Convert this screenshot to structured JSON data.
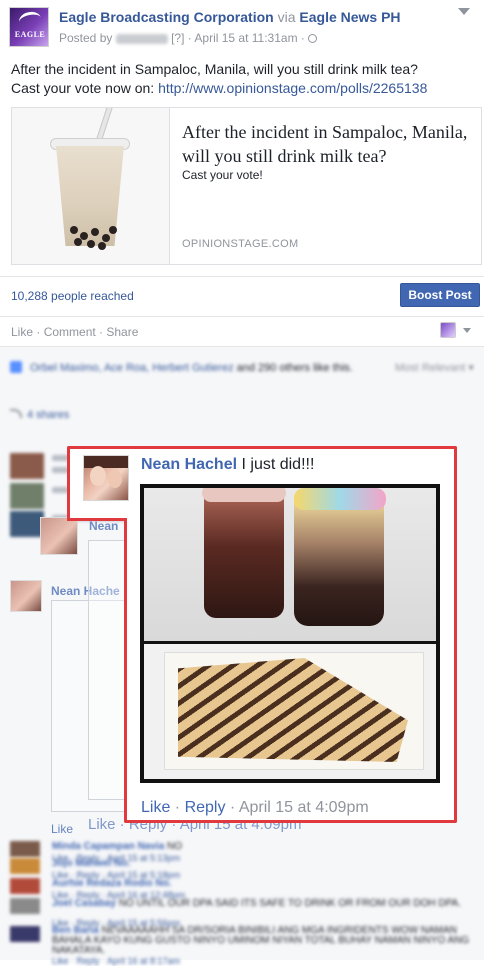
{
  "post": {
    "page_name": "Eagle Broadcasting Corporation",
    "via": "via",
    "via_page": "Eagle News PH",
    "posted_by_label": "Posted by",
    "meta_suffix": "[?] · April 15 at 11:31am ·",
    "avatar_logo_text": "EAGLE",
    "text_line1": "After the incident in Sampaloc, Manila, will you still drink milk tea?",
    "text_line2_prefix": "Cast your vote now on: ",
    "text_link": "http://www.opinionstage.com/polls/2265138"
  },
  "link_card": {
    "title": "After the incident in Sampaloc, Manila, will you still drink milk tea?",
    "description": "Cast your vote!",
    "domain": "OPINIONSTAGE.COM"
  },
  "stats": {
    "reach": "10,288 people reached",
    "boost_label": "Boost Post"
  },
  "actions": {
    "like": "Like",
    "comment": "Comment",
    "share": "Share",
    "sep": " · "
  },
  "feedback": {
    "likes_names": "Orbel Maximo, Ace Roa, Herbert Gutierez",
    "likes_tail": " and 290 others like this.",
    "sort_label": "Most Relevant ▾",
    "shares": "4 shares",
    "faint_name_1": "Nean",
    "faint_name_2": "Nean Hache",
    "faint_like": "Like",
    "faint_like_reply_time": "Like · Reply · April 15 at 4:09pm",
    "bottom_comments": [
      {
        "name": "Minda Capampan Navia",
        "msg": " NO",
        "meta": "Like · Reply · April 15 at 5:13pm",
        "color": "#7a5a4a"
      },
      {
        "name": "Jojo Mahwel No.",
        "msg": "",
        "meta": "Like · Reply · April 15 at 5:18pm",
        "color": "#c98a3a"
      },
      {
        "name": "Aurhie Redaza Rodio No.",
        "msg": "",
        "meta": "Like · Reply · April 16 at 12:48pm",
        "color": "#b24a3a"
      },
      {
        "name": "Joel Casabay",
        "msg": " NO UNTIL OUR DPA SAID ITS SAFE TO DRINK OR FROM OUR DOH DPA.",
        "meta": "Like · Reply · April 15 at 5:56pm",
        "color": "#8a8a8a"
      },
      {
        "name": "Ben Baria",
        "msg": " NEVAAAAAHH SA DR/SORIA BINIBILI ANG MGA INGRIDENTS WOW NAMAN BAHALA KAYO KUNG GUSTO NINYO UMINOM NIYAN TOTAL BUHAY NAMAN NINYO ANG NAKATAYA.",
        "meta": "Like · Reply · April 16 at 8:17am",
        "color": "#3a3a6a"
      }
    ]
  },
  "highlight_comment": {
    "author": "Nean Hachel",
    "text": " I just did!!!",
    "like": "Like",
    "reply": "Reply",
    "sep": " · ",
    "time": "April 15 at 4:09pm"
  },
  "colors": {
    "link_blue": "#365899",
    "boost_blue": "#4267b2",
    "highlight_red": "#e0393e"
  }
}
